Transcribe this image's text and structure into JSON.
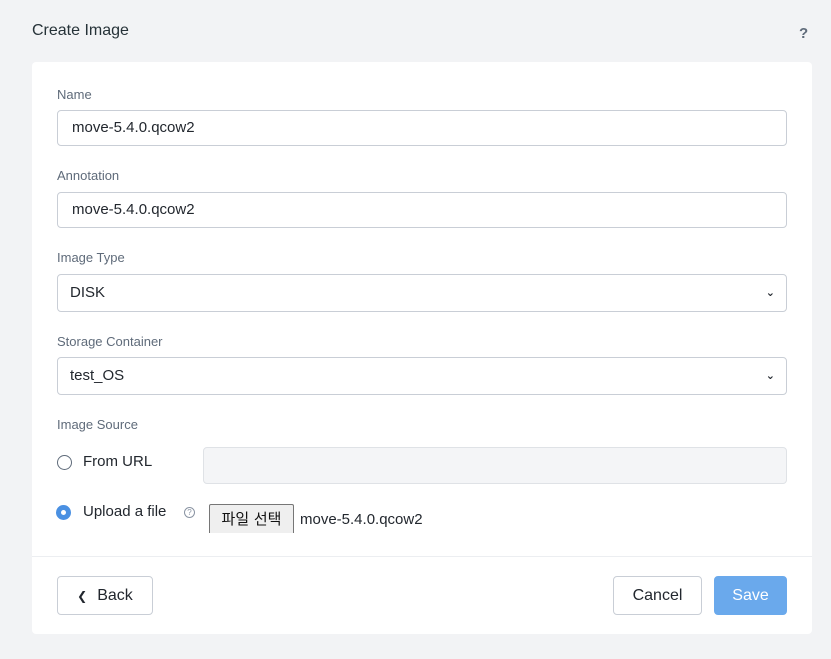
{
  "dialog": {
    "title": "Create Image",
    "help_label": "?"
  },
  "form": {
    "name": {
      "label": "Name",
      "value": "move-5.4.0.qcow2"
    },
    "annotation": {
      "label": "Annotation",
      "value": "move-5.4.0.qcow2"
    },
    "image_type": {
      "label": "Image Type",
      "selected": "DISK"
    },
    "storage_container": {
      "label": "Storage Container",
      "selected": "test_OS"
    },
    "image_source": {
      "label": "Image Source",
      "options": [
        {
          "label": "From URL",
          "checked": false
        },
        {
          "label": "Upload a file",
          "checked": true
        }
      ],
      "file_button_label": "파일 선택",
      "file_name": "move-5.4.0.qcow2"
    }
  },
  "footer": {
    "back_label": "Back",
    "cancel_label": "Cancel",
    "save_label": "Save"
  },
  "colors": {
    "accent": "#4a90e2",
    "save_button": "#6aa9ec",
    "background": "#f2f3f5"
  },
  "icons": {
    "help": "help-icon",
    "chevron": "chevron-down-icon",
    "back": "chevron-left-icon",
    "info": "info-icon"
  }
}
